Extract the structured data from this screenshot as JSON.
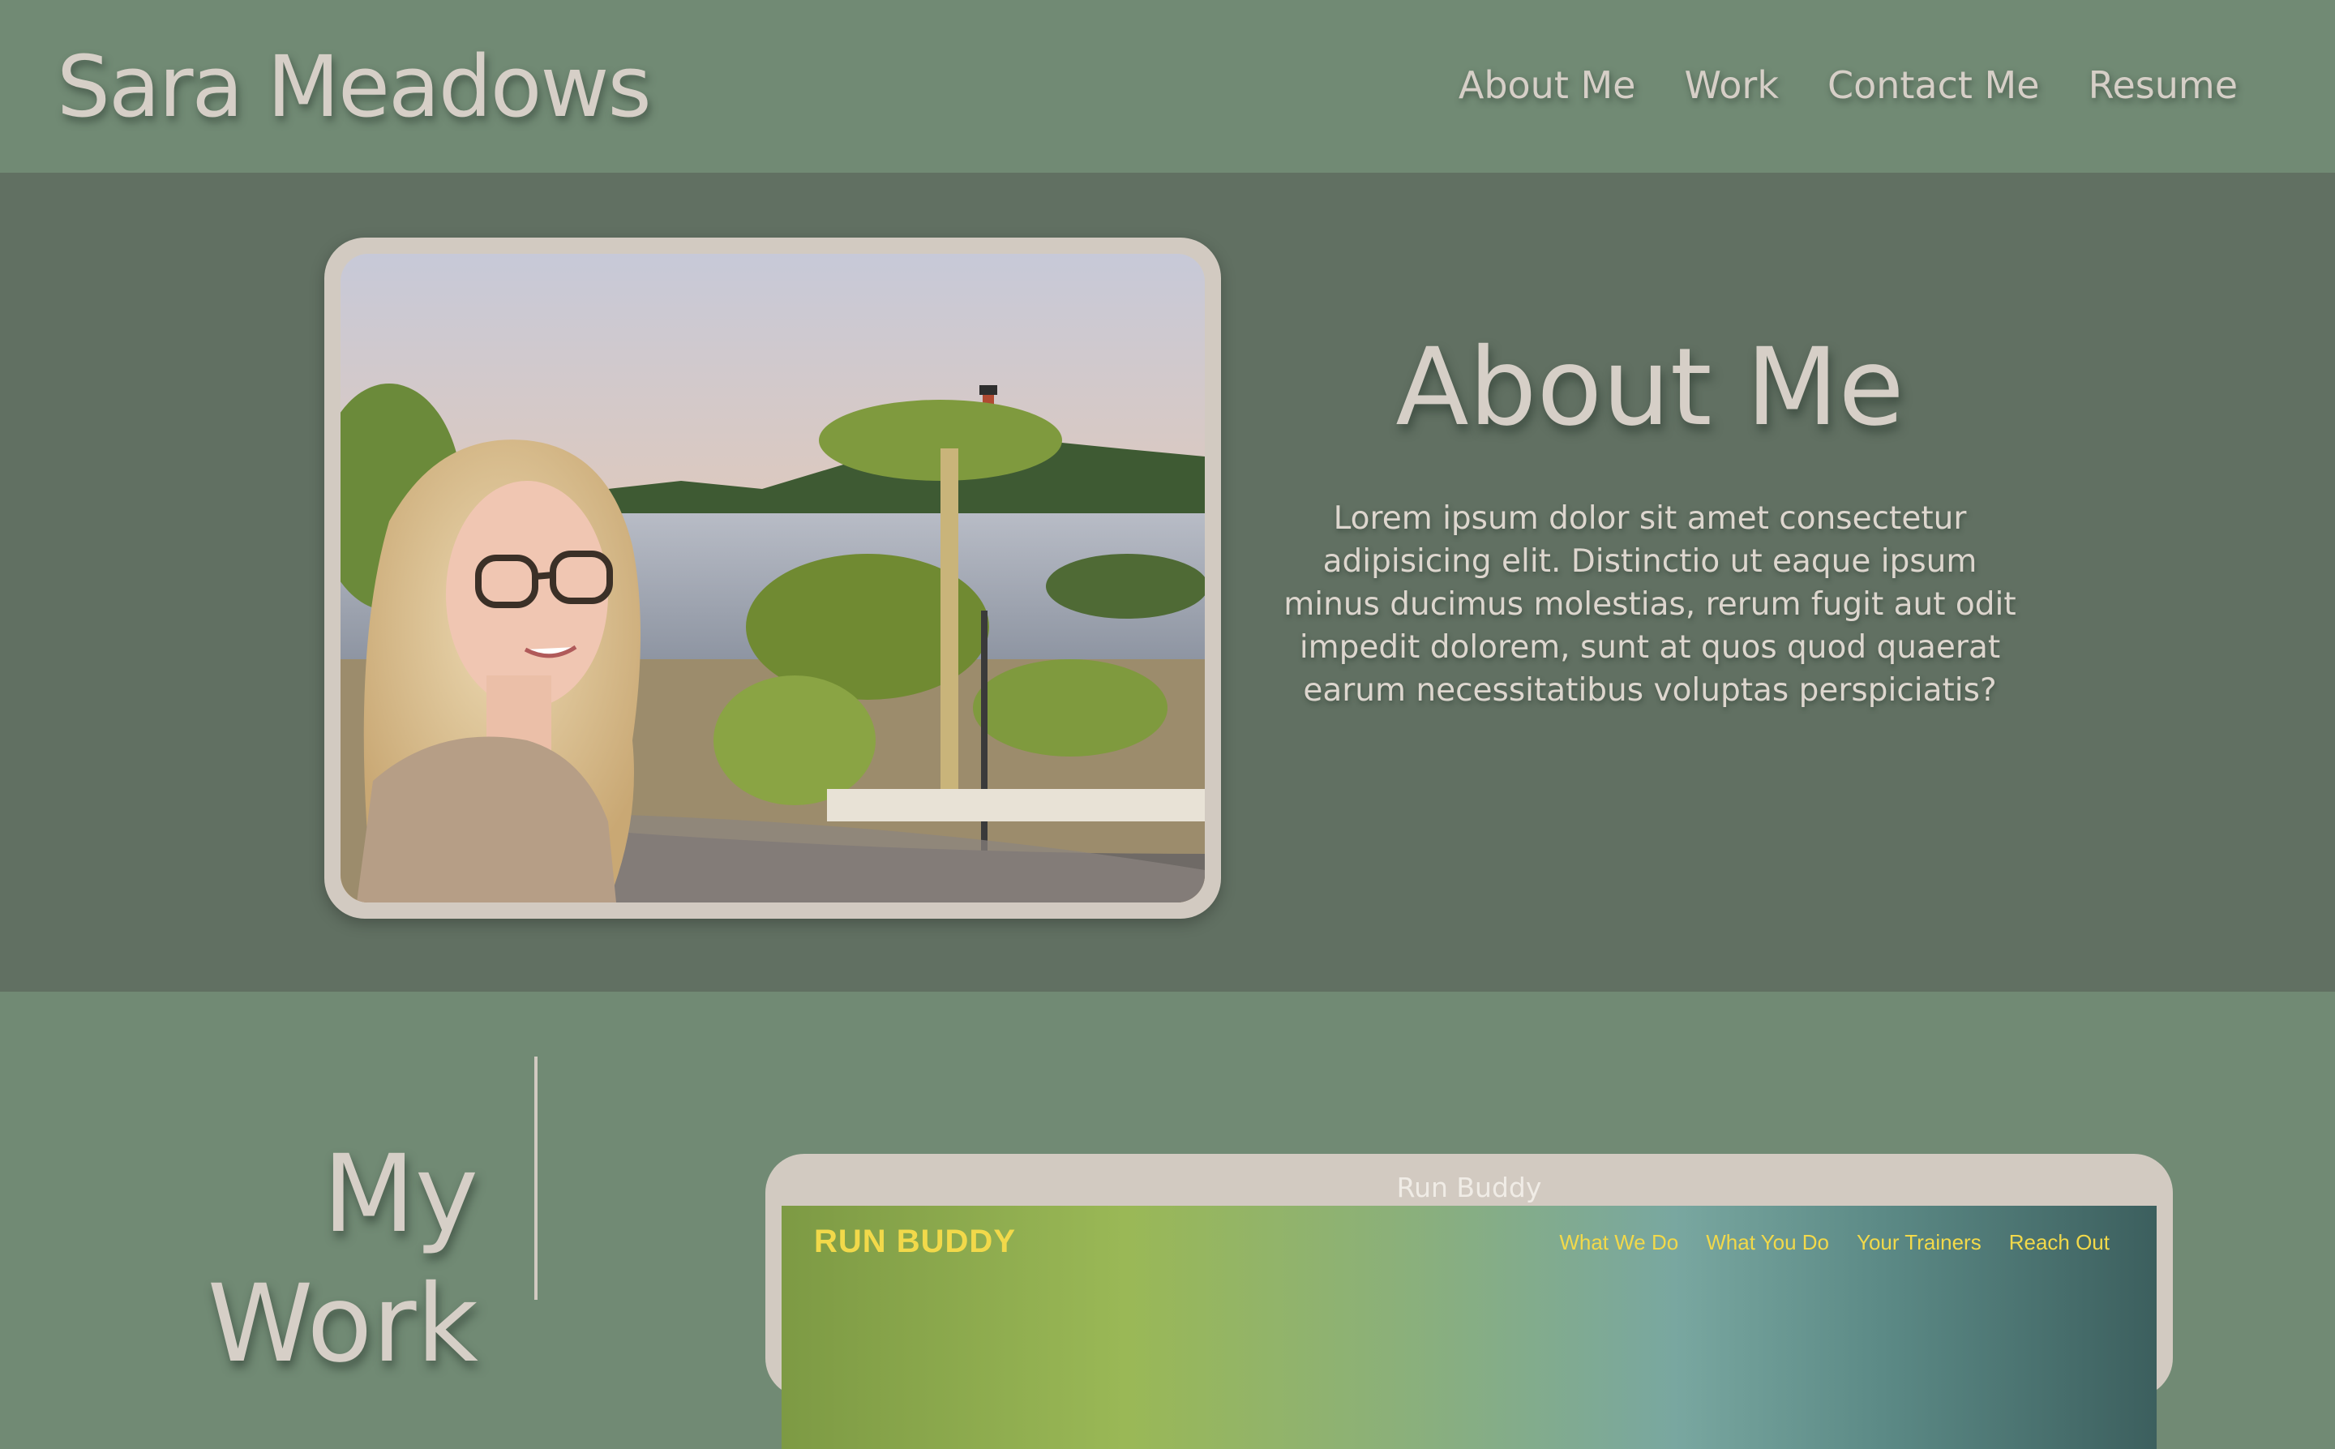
{
  "header": {
    "site_title": "Sara Meadows",
    "nav": [
      "About Me",
      "Work",
      "Contact Me",
      "Resume"
    ]
  },
  "about": {
    "heading": "About Me",
    "body": "Lorem ipsum dolor sit amet consectetur adipisicing elit. Distinctio ut eaque ipsum minus ducimus molestias, rerum fugit aut odit impedit dolorem, sunt at quos quod quaerat earum necessitatibus voluptas perspiciatis?",
    "photo_icon": "portrait-photo"
  },
  "work": {
    "heading": "My Work",
    "project": {
      "title": "Run Buddy",
      "preview": {
        "logo": "RUN BUDDY",
        "nav": [
          "What We Do",
          "What You Do",
          "Your Trainers",
          "Reach Out"
        ]
      }
    }
  },
  "colors": {
    "header_bg": "#718a74",
    "about_bg": "#617062",
    "text": "#d6cfc7",
    "frame": "#d2cac1",
    "run_buddy_accent": "#f2d94a"
  }
}
